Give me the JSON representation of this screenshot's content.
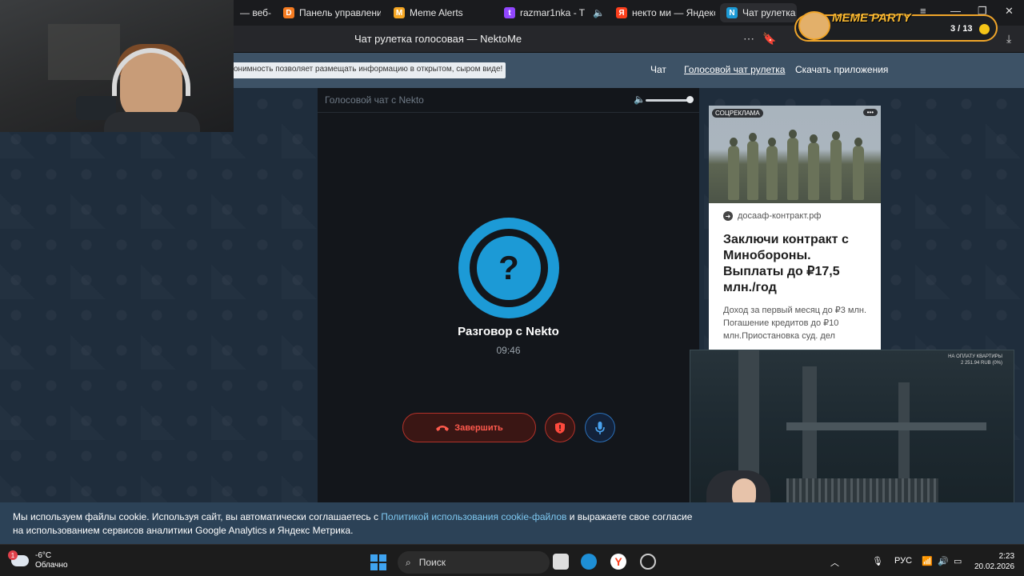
{
  "browser": {
    "tabs": [
      {
        "title": "— веб-",
        "icon": "generic-tab-icon"
      },
      {
        "title": "Панель управления",
        "icon": "donationalerts-icon"
      },
      {
        "title": "Meme Alerts",
        "icon": "meme-alerts-icon"
      },
      {
        "title": "razmar1nka - T",
        "icon": "twitch-icon"
      },
      {
        "title": "некто ми — Яндекс",
        "icon": "yandex-icon"
      },
      {
        "title": "Чат рулетка го",
        "icon": "nekto-icon"
      }
    ],
    "page_title": "Чат рулетка голосовая — NektoMe"
  },
  "site": {
    "notice": "онимность позволяет размещать информацию в открытом, сыром виде!",
    "nav": [
      "Чат",
      "Голосовой чат рулетка",
      "Скачать приложения"
    ]
  },
  "call": {
    "panel_title": "Голосовой чат с Nekto",
    "avatar_glyph": "?",
    "title": "Разговор с Nekto",
    "timer": "09:46",
    "end_label": "Завершить",
    "volume_level": 0.95,
    "accent_color": "#1c9ad6",
    "end_color": "#ff5a4d"
  },
  "ad": {
    "badge": "СОЦРЕКЛАМА",
    "more": "•••",
    "domain": "досааф-контракт.рф",
    "headline": "Заключи контракт с Минобороны. Выплаты до ₽17,5 млн./год",
    "text": "Доход за первый месяц до ₽3 млн. Погашение кредитов до ₽10 млн.Приостановка суд. дел"
  },
  "overlay": {
    "meme_title": "MEME PARTY",
    "meme_count": "3 / 13",
    "game_hud_1": "НА ОПЛАТУ КВАРТИРЫ",
    "game_hud_2": "2 251.94 RUB (0%)"
  },
  "cookie": {
    "text_before": "Мы используем файлы cookie. Используя сайт, вы автоматически соглашаетесь с ",
    "link": "Политикой использования cookie-файлов",
    "text_after": " и выражаете свое согласие на использованием сервисов аналитики Google Analytics и Яндекс Метрика."
  },
  "taskbar": {
    "weather_badge": "1",
    "temp": "-6°C",
    "condition": "Облачно",
    "search": "Поиск",
    "lang": "РУС",
    "time": "2:23",
    "date": "20.02.2026"
  }
}
